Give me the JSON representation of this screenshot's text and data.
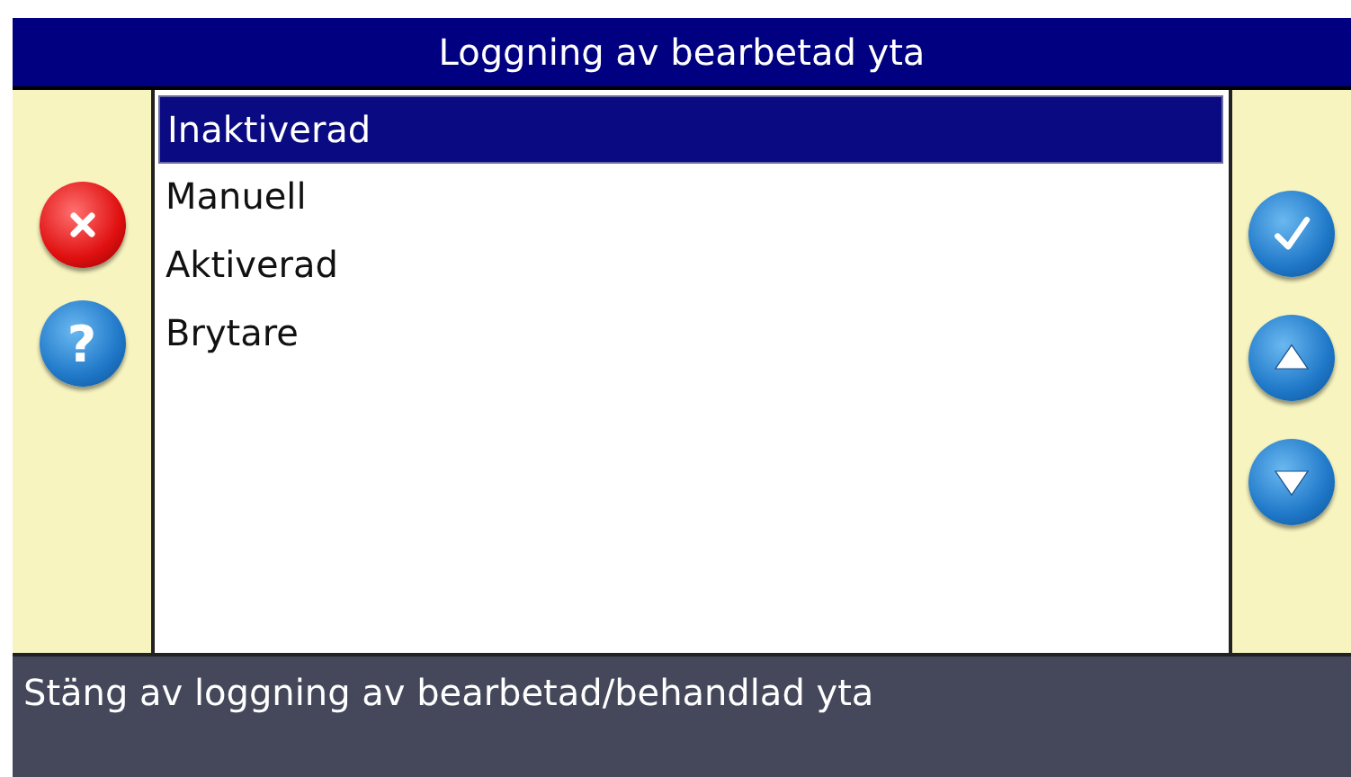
{
  "window": {
    "title": "Loggning av bearbetad yta"
  },
  "left_buttons": [
    {
      "kind": "cancel"
    },
    {
      "kind": "help",
      "glyph": "?"
    }
  ],
  "list": [
    {
      "label": "Inaktiverad",
      "selected": true
    },
    {
      "label": "Manuell",
      "selected": false
    },
    {
      "label": "Aktiverad",
      "selected": false
    },
    {
      "label": "Brytare",
      "selected": false
    }
  ],
  "right_buttons": [
    {
      "kind": "ok"
    },
    {
      "kind": "up"
    },
    {
      "kind": "down"
    }
  ],
  "status_bar": "Stäng av loggning av bearbetad/behandlad yta"
}
